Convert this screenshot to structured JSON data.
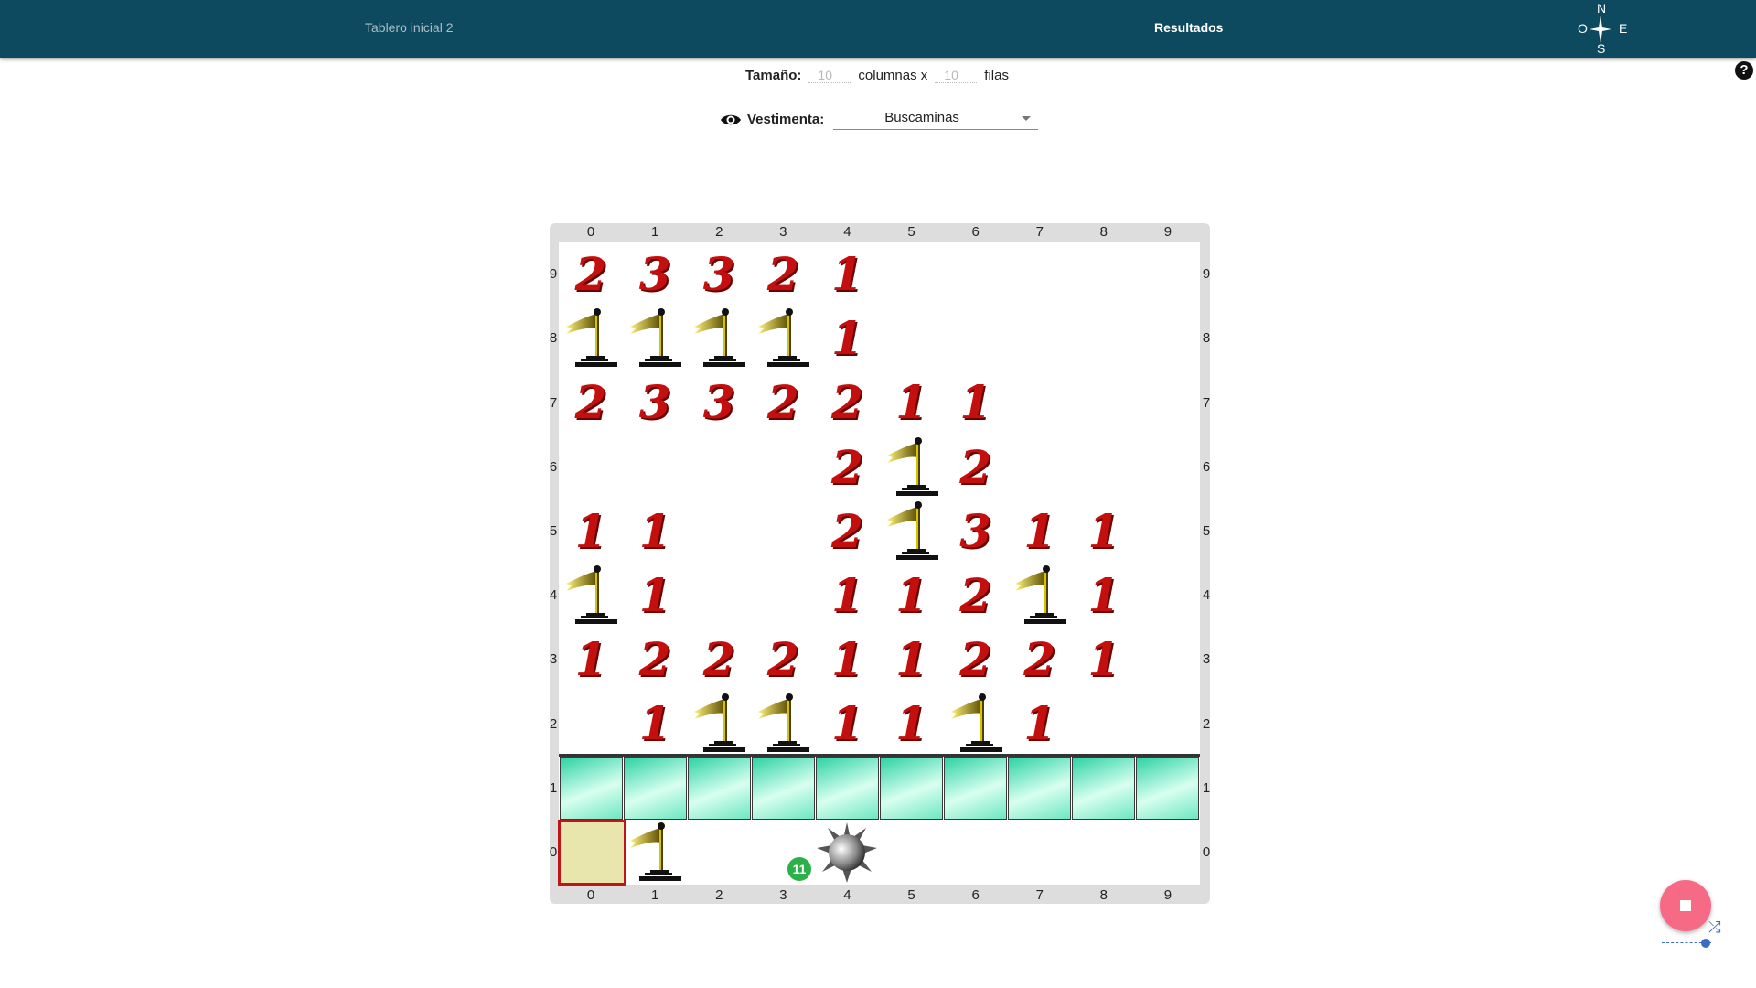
{
  "header": {
    "tab_left": "Tablero inicial 2",
    "tab_right": "Resultados",
    "compass": {
      "n": "N",
      "s": "S",
      "w": "O",
      "e": "E"
    }
  },
  "help_label": "?",
  "size": {
    "label": "Tamaño:",
    "cols": "10",
    "cols_label": "columnas x",
    "rows": "10",
    "rows_label": "filas"
  },
  "vestimenta": {
    "label": "Vestimenta:",
    "value": "Buscaminas"
  },
  "board": {
    "col_labels": [
      "0",
      "1",
      "2",
      "3",
      "4",
      "5",
      "6",
      "7",
      "8",
      "9"
    ],
    "row_labels": [
      "9",
      "8",
      "7",
      "6",
      "5",
      "4",
      "3",
      "2",
      "1",
      "0"
    ],
    "cells": [
      [
        "2",
        "3",
        "3",
        "2",
        "1",
        "",
        "",
        "",
        "",
        ""
      ],
      [
        "F",
        "F",
        "F",
        "F",
        "1",
        "",
        "",
        "",
        "",
        ""
      ],
      [
        "2",
        "3",
        "3",
        "2",
        "2",
        "1",
        "1",
        "",
        "",
        ""
      ],
      [
        "",
        "",
        "",
        "",
        "2",
        "F",
        "2",
        "",
        "",
        ""
      ],
      [
        "1",
        "1",
        "",
        "",
        "2",
        "F",
        "3",
        "1",
        "1",
        ""
      ],
      [
        "F",
        "1",
        "",
        "",
        "1",
        "1",
        "2",
        "F",
        "1",
        ""
      ],
      [
        "1",
        "2",
        "2",
        "2",
        "1",
        "1",
        "2",
        "2",
        "1",
        ""
      ],
      [
        "",
        "1",
        "F",
        "F",
        "1",
        "1",
        "F",
        "1",
        "",
        ""
      ],
      [
        "W",
        "W",
        "W",
        "W",
        "W",
        "W",
        "W",
        "W",
        "W",
        "W"
      ],
      [
        "C",
        "F",
        "",
        "",
        "M",
        "",
        "",
        "",
        "",
        ""
      ]
    ],
    "badge": "11"
  },
  "colors": {
    "header": "#0e4a5f",
    "number": "#c40f0f",
    "cursor_border": "#c0141b",
    "fab": "#f76a86"
  }
}
